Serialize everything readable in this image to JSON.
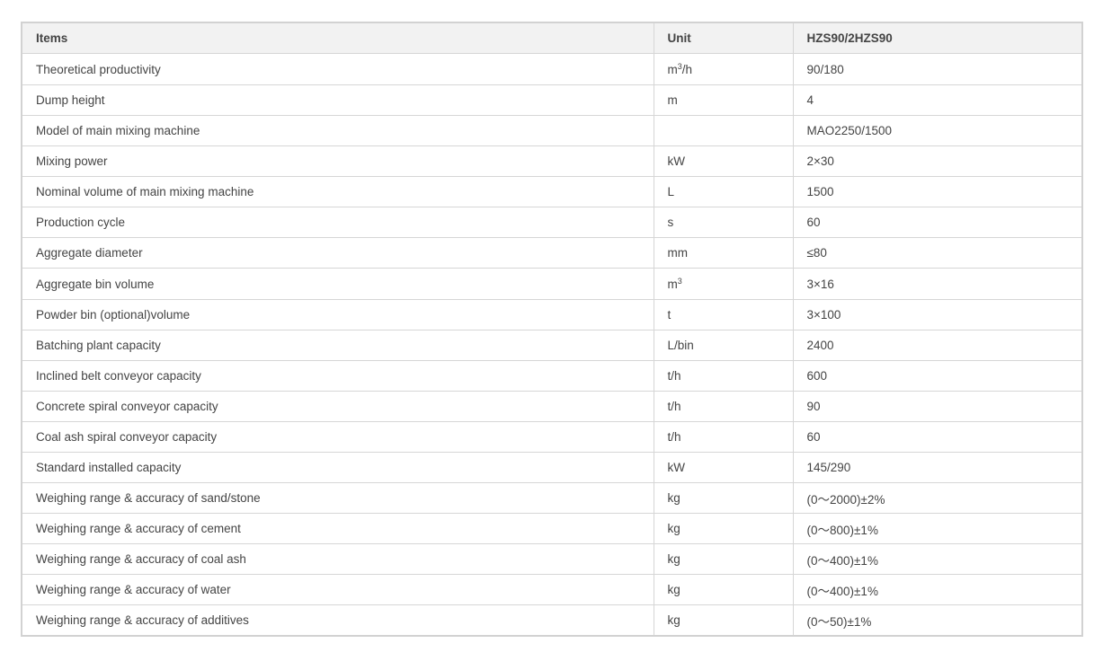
{
  "table": {
    "headers": [
      "Items",
      "Unit",
      "HZS90/2HZS90"
    ],
    "rows": [
      {
        "item": "Theoretical productivity",
        "unit_base": "m",
        "unit_sup": "3",
        "unit_tail": "/h",
        "value": "90/180"
      },
      {
        "item": "Dump height",
        "unit_base": "m",
        "unit_sup": "",
        "unit_tail": "",
        "value": "4"
      },
      {
        "item": "Model of main mixing machine",
        "unit_base": "",
        "unit_sup": "",
        "unit_tail": "",
        "value": "MAO2250/1500"
      },
      {
        "item": "Mixing power",
        "unit_base": "kW",
        "unit_sup": "",
        "unit_tail": "",
        "value": "2×30"
      },
      {
        "item": "Nominal volume of main mixing machine",
        "unit_base": "L",
        "unit_sup": "",
        "unit_tail": "",
        "value": "1500"
      },
      {
        "item": "Production cycle",
        "unit_base": "s",
        "unit_sup": "",
        "unit_tail": "",
        "value": "60"
      },
      {
        "item": "Aggregate diameter",
        "unit_base": "mm",
        "unit_sup": "",
        "unit_tail": "",
        "value": "≤80"
      },
      {
        "item": "Aggregate bin volume",
        "unit_base": "m",
        "unit_sup": "3",
        "unit_tail": "",
        "value": "3×16"
      },
      {
        "item": "Powder bin (optional)volume",
        "unit_base": "t",
        "unit_sup": "",
        "unit_tail": "",
        "value": "3×100"
      },
      {
        "item": "Batching plant capacity",
        "unit_base": "L/bin",
        "unit_sup": "",
        "unit_tail": "",
        "value": "2400"
      },
      {
        "item": "Inclined belt conveyor capacity",
        "unit_base": "t/h",
        "unit_sup": "",
        "unit_tail": "",
        "value": "600"
      },
      {
        "item": "Concrete spiral conveyor capacity",
        "unit_base": "t/h",
        "unit_sup": "",
        "unit_tail": "",
        "value": "90"
      },
      {
        "item": "Coal ash spiral conveyor capacity",
        "unit_base": "t/h",
        "unit_sup": "",
        "unit_tail": "",
        "value": "60"
      },
      {
        "item": "Standard installed capacity",
        "unit_base": "kW",
        "unit_sup": "",
        "unit_tail": "",
        "value": "145/290"
      },
      {
        "item": "Weighing range & accuracy of sand/stone",
        "unit_base": "kg",
        "unit_sup": "",
        "unit_tail": "",
        "value": "(0～2000)±2%"
      },
      {
        "item": "Weighing range & accuracy of cement",
        "unit_base": "kg",
        "unit_sup": "",
        "unit_tail": "",
        "value": "(0～800)±1%"
      },
      {
        "item": "Weighing range & accuracy of coal ash",
        "unit_base": "kg",
        "unit_sup": "",
        "unit_tail": "",
        "value": "(0～400)±1%"
      },
      {
        "item": "Weighing range & accuracy of water",
        "unit_base": "kg",
        "unit_sup": "",
        "unit_tail": "",
        "value": "(0～400)±1%"
      },
      {
        "item": "Weighing range & accuracy of additives",
        "unit_base": "kg",
        "unit_sup": "",
        "unit_tail": "",
        "value": "(0～50)±1%"
      }
    ]
  },
  "colors": {
    "header_bg": "#f2f2f2",
    "border": "#d6d6d6",
    "text": "#444444"
  }
}
